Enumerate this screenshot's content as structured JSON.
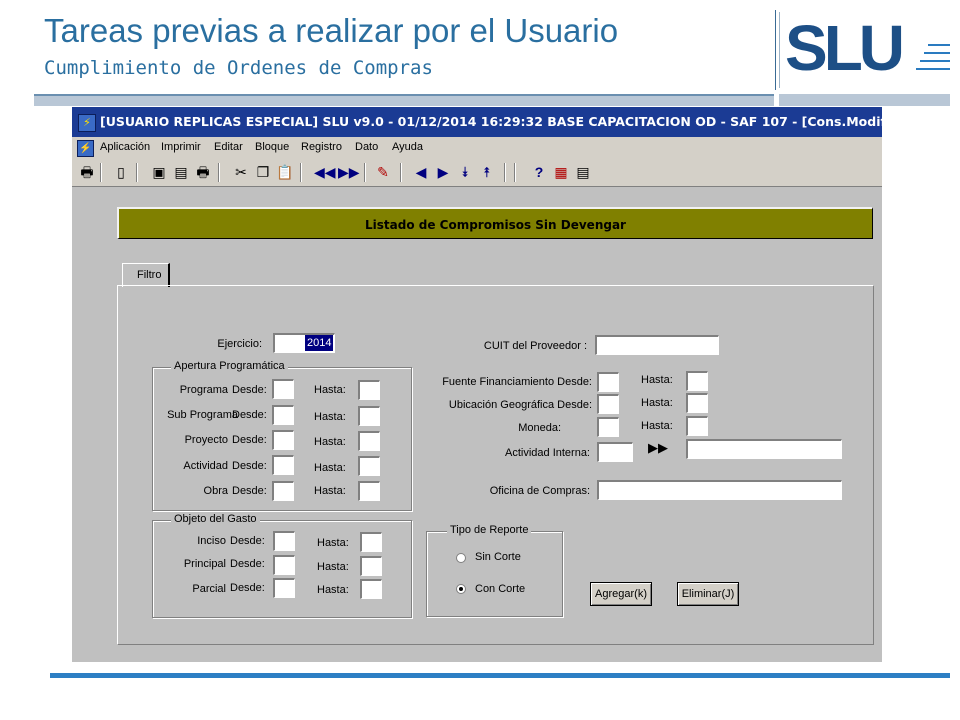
{
  "slide": {
    "title": "Tareas previas a realizar por el Usuario",
    "subtitle": "Cumplimiento de Ordenes de Compras",
    "logo_text": "SLU"
  },
  "window": {
    "title": "[USUARIO REPLICAS ESPECIAL]  SLU v9.0 - 01/12/2014 16:29:32 BASE CAPACITACION OD - SAF 107 - [Cons.Modif.]"
  },
  "menu": [
    "Aplicación",
    "Imprimir",
    "Editar",
    "Bloque",
    "Registro",
    "Dato",
    "Ayuda"
  ],
  "toolbar_icons": [
    "print-icon",
    "exit-icon",
    "window-icon",
    "save-icon",
    "print-preview-icon",
    "cut-icon",
    "copy-icon",
    "paste-icon",
    "first-record-icon",
    "last-record-icon",
    "edit-icon",
    "prev-icon",
    "next-icon",
    "down-block-icon",
    "up-block-icon",
    "help-icon",
    "report-icon",
    "list-icon"
  ],
  "banner": "Listado de Compromisos Sin Devengar",
  "tab": "Filtro",
  "form": {
    "ejercicio_label": "Ejercicio:",
    "ejercicio_value": "2014",
    "cuit_label": "CUIT del Proveedor :",
    "apertura": {
      "title": "Apertura Programática",
      "rows": [
        {
          "label": "Programa",
          "desde": "Desde:",
          "hasta": "Hasta:"
        },
        {
          "label": "Sub Programa",
          "desde": "Desde:",
          "hasta": "Hasta:"
        },
        {
          "label": "Proyecto",
          "desde": "Desde:",
          "hasta": "Hasta:"
        },
        {
          "label": "Actividad",
          "desde": "Desde:",
          "hasta": "Hasta:"
        },
        {
          "label": "Obra",
          "desde": "Desde:",
          "hasta": "Hasta:"
        }
      ]
    },
    "objeto": {
      "title": "Objeto del Gasto",
      "rows": [
        {
          "label": "Inciso",
          "desde": "Desde:",
          "hasta": "Hasta:"
        },
        {
          "label": "Principal",
          "desde": "Desde:",
          "hasta": "Hasta:"
        },
        {
          "label": "Parcial",
          "desde": "Desde:",
          "hasta": "Hasta:"
        }
      ]
    },
    "fuente_label": "Fuente Financiamiento Desde:",
    "ubicacion_label": "Ubicación Geográfica Desde:",
    "moneda_label": "Moneda:",
    "hasta_label": "Hasta:",
    "actividad_interna_label": "Actividad Interna:",
    "oficina_label": "Oficina de Compras:",
    "tipo_reporte": {
      "title": "Tipo de Reporte",
      "options": [
        "Sin Corte",
        "Con Corte"
      ],
      "selected": "Con Corte"
    },
    "agregar_label": "Agregar(k)",
    "eliminar_label": "Eliminar(J)"
  }
}
